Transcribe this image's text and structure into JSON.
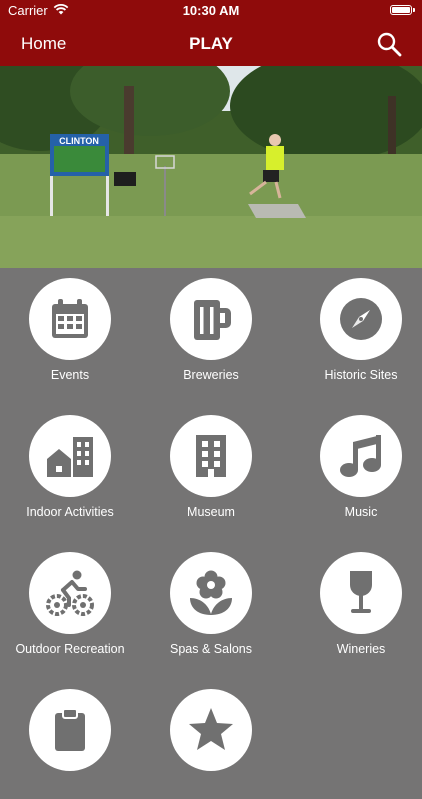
{
  "status_bar": {
    "carrier": "Carrier",
    "time": "10:30 AM"
  },
  "nav": {
    "back_label": "Home",
    "title": "PLAY"
  },
  "hero": {
    "sign_text": "CLINTON"
  },
  "tiles": [
    {
      "label": "Events",
      "icon": "calendar-icon"
    },
    {
      "label": "Breweries",
      "icon": "beer-mug-icon"
    },
    {
      "label": "Historic Sites",
      "icon": "compass-icon"
    },
    {
      "label": "Indoor Activities",
      "icon": "buildings-icon"
    },
    {
      "label": "Museum",
      "icon": "building-icon"
    },
    {
      "label": "Music",
      "icon": "music-note-icon"
    },
    {
      "label": "Outdoor Recreation",
      "icon": "cyclist-icon"
    },
    {
      "label": "Spas & Salons",
      "icon": "flower-icon"
    },
    {
      "label": "Wineries",
      "icon": "wine-glass-icon"
    },
    {
      "label": "",
      "icon": "clipboard-icon"
    },
    {
      "label": "",
      "icon": "star-icon"
    }
  ],
  "colors": {
    "accent": "#8f0b0b",
    "background": "#757474",
    "icon": "#707070"
  }
}
